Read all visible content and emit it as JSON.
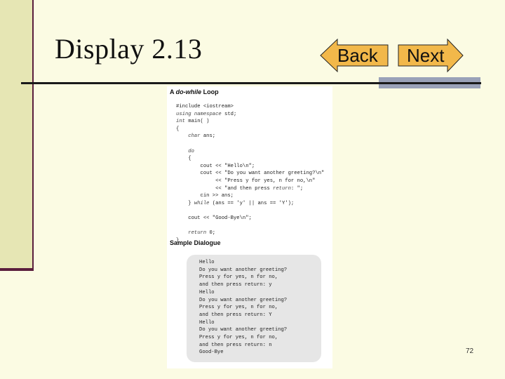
{
  "slide": {
    "title": "Display 2.13",
    "page_number": "72"
  },
  "nav": {
    "back_label": "Back",
    "next_label": "Next",
    "arrow_fill": "#f2b84a"
  },
  "figure": {
    "heading_prefix": "A ",
    "heading_keyword": "do-while",
    "heading_suffix": " Loop",
    "code_lines": [
      "#include <iostream>",
      "using namespace std;",
      "int main( )",
      "{",
      "    char ans;",
      "",
      "    do",
      "    {",
      "        cout << \"Hello\\n\";",
      "        cout << \"Do you want another greeting?\\n\"",
      "             << \"Press y for yes, n for no,\\n\"",
      "             << \"and then press return: \";",
      "        cin >> ans;",
      "    } while (ans == 'y' || ans == 'Y');",
      "",
      "    cout << \"Good-Bye\\n\";",
      "",
      "    return 0;",
      "}"
    ],
    "sample_heading": "Sample Dialogue",
    "dialogue_lines": [
      "Hello",
      "Do you want another greeting?",
      "Press y for yes, n for no,",
      "and then press return: y",
      "Hello",
      "Do you want another greeting?",
      "Press y for yes, n for no,",
      "and then press return: Y",
      "Hello",
      "Do you want another greeting?",
      "Press y for yes, n for no,",
      "and then press return: n",
      "Good-Bye"
    ]
  }
}
